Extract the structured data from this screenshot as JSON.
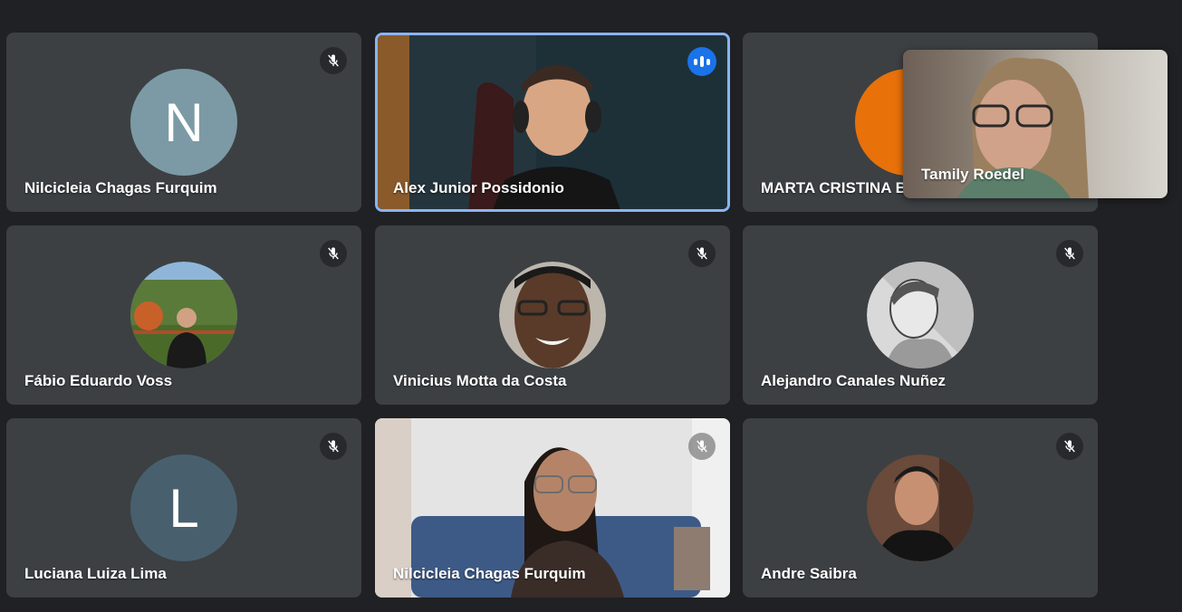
{
  "participants": [
    {
      "name": "Nilcicleia Chagas Furquim",
      "avatar_letter": "N",
      "muted": true
    },
    {
      "name": "Alex Junior Possidonio",
      "speaking": true,
      "muted": false
    },
    {
      "name": "MARTA CRISTINA B",
      "muted": true
    },
    {
      "name": "Fábio Eduardo Voss",
      "muted": true
    },
    {
      "name": "Vinicius Motta da Costa",
      "muted": true
    },
    {
      "name": "Alejandro Canales Nuñez",
      "muted": true
    },
    {
      "name": "Luciana Luiza Lima",
      "avatar_letter": "L",
      "muted": true
    },
    {
      "name": "Nilcicleia Chagas Furquim",
      "muted": true
    },
    {
      "name": "Andre Saibra",
      "muted": true
    }
  ],
  "self_view": {
    "name": "Tamily Roedel"
  },
  "icons": {
    "mic_off": "mic-off-icon",
    "speaking": "speaking-indicator-icon"
  },
  "colors": {
    "background": "#202124",
    "tile": "#3c4043",
    "speaking_border": "#8ab4f8",
    "speaking_badge": "#1a73e8"
  }
}
